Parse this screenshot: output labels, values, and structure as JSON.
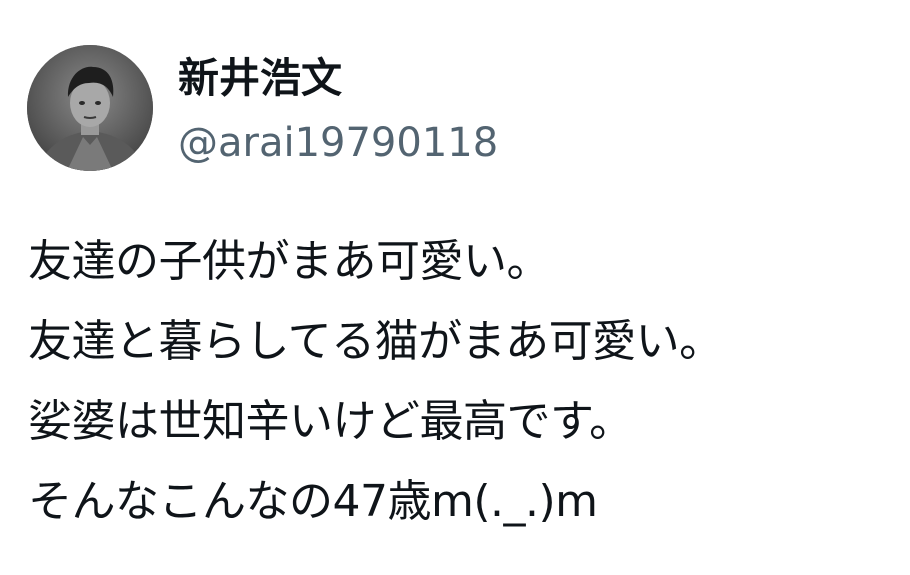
{
  "author": {
    "display_name": "新井浩文",
    "handle": "@arai19790118",
    "avatar_icon": "profile-photo-grayscale"
  },
  "tweet": {
    "lines": [
      "友達の子供がまあ可愛い。",
      "友達と暮らしてる猫がまあ可愛い。",
      "娑婆は世知辛いけど最高です。",
      "そんなこんなの47歳m(._.)m"
    ]
  },
  "colors": {
    "name_text": "#0f1419",
    "handle_text": "#536471",
    "body_text": "#0f1419",
    "background": "#ffffff"
  }
}
